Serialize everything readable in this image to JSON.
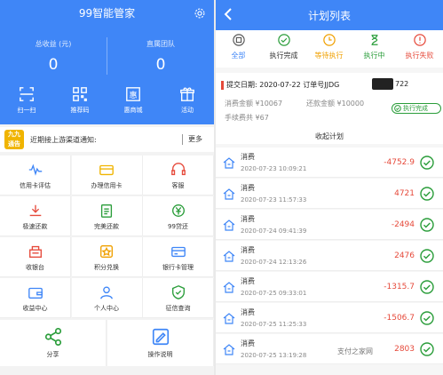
{
  "left": {
    "title": "99智能管家",
    "stats": [
      {
        "label": "总收益 (元)",
        "value": "0"
      },
      {
        "label": "直属团队",
        "value": "0"
      }
    ],
    "quick_actions": [
      {
        "label": "扫一扫",
        "icon": "scan-icon"
      },
      {
        "label": "推荐码",
        "icon": "qrcode-icon"
      },
      {
        "label": "惠商城",
        "icon": "mall-icon"
      },
      {
        "label": "活动",
        "icon": "gift-icon"
      }
    ],
    "notice": {
      "badge": "九九\n通告",
      "text": "近期接上游渠道通知:",
      "more": "更多"
    },
    "grid": [
      {
        "label": "信用卡评估",
        "icon": "pulse-icon"
      },
      {
        "label": "办理信用卡",
        "icon": "card-icon"
      },
      {
        "label": "客服",
        "icon": "headset-icon"
      },
      {
        "label": "极速还款",
        "icon": "fast-repay-icon"
      },
      {
        "label": "完美还款",
        "icon": "clipboard-icon"
      },
      {
        "label": "99贷还",
        "icon": "loan-icon"
      },
      {
        "label": "收银台",
        "icon": "cashier-icon"
      },
      {
        "label": "积分兑换",
        "icon": "points-icon"
      },
      {
        "label": "银行卡管理",
        "icon": "bank-card-icon"
      },
      {
        "label": "收益中心",
        "icon": "wallet-icon"
      },
      {
        "label": "个人中心",
        "icon": "person-icon"
      },
      {
        "label": "征信查询",
        "icon": "credit-check-icon"
      }
    ],
    "bottom": [
      {
        "label": "分享",
        "icon": "share-icon"
      },
      {
        "label": "操作说明",
        "icon": "manual-icon"
      }
    ]
  },
  "right": {
    "title": "计划列表",
    "tabs": [
      {
        "label": "全部",
        "color": "#3f86f7"
      },
      {
        "label": "执行完成",
        "color": "#2a9d3a"
      },
      {
        "label": "等待执行",
        "color": "#f0a000"
      },
      {
        "label": "执行中",
        "color": "#2a9d3a"
      },
      {
        "label": "执行失败",
        "color": "#e64a3b"
      }
    ],
    "plan": {
      "title": "提交日期: 2020-07-22  订单号JJDG",
      "order_tail": "722",
      "amount": "消费金额 ¥10067",
      "repay": "还款金额 ¥10000",
      "fee": "手续费共 ¥67",
      "status": "执行完成",
      "subtitle": "收起计划"
    },
    "rows": [
      {
        "name": "消费",
        "time": "2020-07-23 10:09:21",
        "amount": "-4752.9"
      },
      {
        "name": "消费",
        "time": "2020-07-23 11:57:33",
        "amount": "4721"
      },
      {
        "name": "消费",
        "time": "2020-07-24 09:41:39",
        "amount": "-2494"
      },
      {
        "name": "消费",
        "time": "2020-07-24 12:13:26",
        "amount": "2476"
      },
      {
        "name": "消费",
        "time": "2020-07-25 09:33:01",
        "amount": "-1315.7"
      },
      {
        "name": "消费",
        "time": "2020-07-25 11:25:33",
        "amount": "-1506.7"
      },
      {
        "name": "消费",
        "time": "2020-07-25 13:19:28",
        "amount": "2803"
      }
    ]
  },
  "watermark": "支付之家网",
  "colors": {
    "primary": "#3f86f7",
    "red": "#e64a3b",
    "green": "#2a9d3a",
    "orange": "#f0a000"
  }
}
